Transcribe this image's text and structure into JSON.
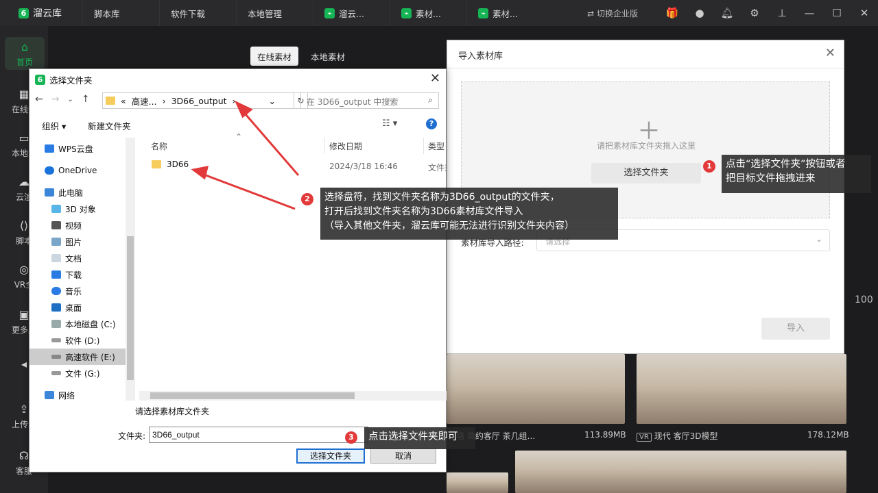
{
  "topbar": {
    "app_name": "溜云库",
    "tabs": [
      "脚本库",
      "软件下载",
      "本地管理",
      "溜云...",
      "素材...",
      "素材..."
    ],
    "switch_label": "⇄ 切换企业版"
  },
  "sidebar": {
    "items": [
      "首页",
      "在线素",
      "本地管",
      "云渲",
      "脚本",
      "VR全",
      "更多工",
      "上传素",
      "客服"
    ]
  },
  "main": {
    "seg_tabs": [
      "在线素材",
      "本地素材"
    ],
    "cards": [
      {
        "caption": "景墙 简约客厅 茶几组...",
        "size": "113.89MB"
      },
      {
        "badge": "VR",
        "caption": "现代 客厅3D模型",
        "size": "178.12MB"
      }
    ],
    "count_fragment": "100"
  },
  "import_dialog": {
    "title": "导入素材库",
    "drop_hint": "请把素材库文件夹拖入这里",
    "choose_button": "选择文件夹",
    "path_label": "素材库导入路径:",
    "path_placeholder": "请选择",
    "import_button": "导入"
  },
  "file_dialog": {
    "title": "选择文件夹",
    "address": [
      "«",
      "高速...",
      "›",
      "3D66_output",
      "›"
    ],
    "search_placeholder": "在 3D66_output 中搜索",
    "organize": "组织 ▾",
    "new_folder": "新建文件夹",
    "tree": [
      "WPS云盘",
      "OneDrive",
      "此电脑",
      "3D 对象",
      "视频",
      "图片",
      "文档",
      "下载",
      "音乐",
      "桌面",
      "本地磁盘 (C:)",
      "软件 (D:)",
      "高速软件 (E:)",
      "文件 (G:)",
      "网络"
    ],
    "columns": [
      "名称",
      "修改日期",
      "类型"
    ],
    "files": [
      {
        "name": "3D66",
        "date": "2024/3/18 16:46",
        "type": "文件夹"
      }
    ],
    "status": "请选择素材库文件夹",
    "filename_label": "文件夹:",
    "filename_value": "3D66_output",
    "ok_button": "选择文件夹",
    "cancel_button": "取消"
  },
  "annotations": [
    {
      "num": "1",
      "text": "点击“选择文件夹”按钮或者\n把目标文件拖拽进来"
    },
    {
      "num": "2",
      "text": "选择盘符，找到文件夹名称为3D66_output的文件夹，\n打开后找到文件夹名称为3D66素材库文件导入\n（导入其他文件夹，溜云库可能无法进行识别文件夹内容）"
    },
    {
      "num": "3",
      "text": "点击选择文件夹即可"
    }
  ],
  "colors": {
    "brand": "#16b455",
    "annotation_red": "#e23a3a",
    "dark_bg": "#1c1c1e"
  }
}
